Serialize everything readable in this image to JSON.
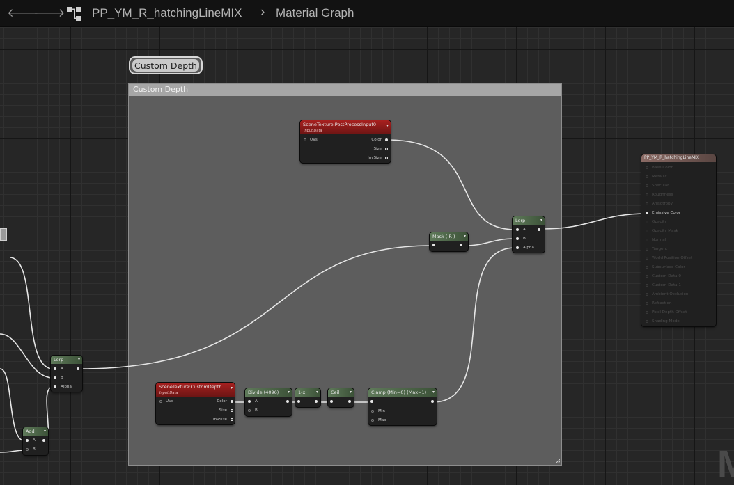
{
  "topbar": {
    "back_icon": "arrow-left-icon",
    "forward_icon": "arrow-right-icon",
    "graph_icon": "material-graph-icon",
    "asset_name": "PP_YM_R_hatchingLineMIX",
    "separator": "›",
    "graph_name": "Material Graph"
  },
  "comment": {
    "bubble_label": "Custom Depth",
    "box_title": "Custom Depth"
  },
  "nodes": {
    "scene_postprocess": {
      "title": "SceneTexture:PostProcessInput0",
      "subtitle": "Input Data",
      "input": "UVs",
      "outputs": [
        "Color",
        "Size",
        "InvSize"
      ]
    },
    "scene_customdepth": {
      "title": "SceneTexture:CustomDepth",
      "subtitle": "Input Data",
      "input": "UVs",
      "outputs": [
        "Color",
        "Size",
        "InvSize"
      ]
    },
    "mask_r": {
      "title": "Mask ( R )"
    },
    "lerp_main": {
      "title": "Lerp",
      "pins": [
        "A",
        "B",
        "Alpha"
      ]
    },
    "lerp_left": {
      "title": "Lerp",
      "pins": [
        "A",
        "B",
        "Alpha"
      ]
    },
    "add": {
      "title": "Add",
      "pins": [
        "A",
        "B"
      ]
    },
    "divide": {
      "title": "Divide (4096)",
      "pins": [
        "A",
        "B"
      ]
    },
    "one_minus": {
      "title": "1-x"
    },
    "ceil": {
      "title": "Ceil"
    },
    "clamp": {
      "title": "Clamp (Min=0) (Max=1)",
      "pins": [
        "Min",
        "Max"
      ]
    },
    "output": {
      "title": "PP_YM_R_hatchingLineMIX",
      "pins": [
        {
          "label": "Base Color",
          "active": false
        },
        {
          "label": "Metallic",
          "active": false
        },
        {
          "label": "Specular",
          "active": false
        },
        {
          "label": "Roughness",
          "active": false
        },
        {
          "label": "Anisotropy",
          "active": false
        },
        {
          "label": "Emissive Color",
          "active": true
        },
        {
          "label": "Opacity",
          "active": false
        },
        {
          "label": "Opacity Mask",
          "active": false
        },
        {
          "label": "Normal",
          "active": false
        },
        {
          "label": "Tangent",
          "active": false
        },
        {
          "label": "World Position Offset",
          "active": false
        },
        {
          "label": "Subsurface Color",
          "active": false
        },
        {
          "label": "Custom Data 0",
          "active": false
        },
        {
          "label": "Custom Data 1",
          "active": false
        },
        {
          "label": "Ambient Occlusion",
          "active": false
        },
        {
          "label": "Refraction",
          "active": false
        },
        {
          "label": "Pixel Depth Offset",
          "active": false
        },
        {
          "label": "Shading Model",
          "active": false
        }
      ]
    }
  },
  "watermark": "M"
}
